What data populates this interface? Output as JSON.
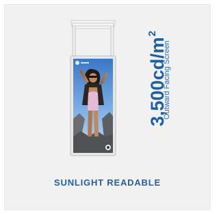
{
  "product": {
    "brightness_value": "3,500cd/m",
    "brightness_exponent": "2",
    "subtitle": "Outward Facing Screen",
    "caption": "SUNLIGHT READABLE"
  },
  "colors": {
    "text_primary": "#1f5fa0",
    "background": "#f1f1f1",
    "frame": "#eaeaea"
  }
}
